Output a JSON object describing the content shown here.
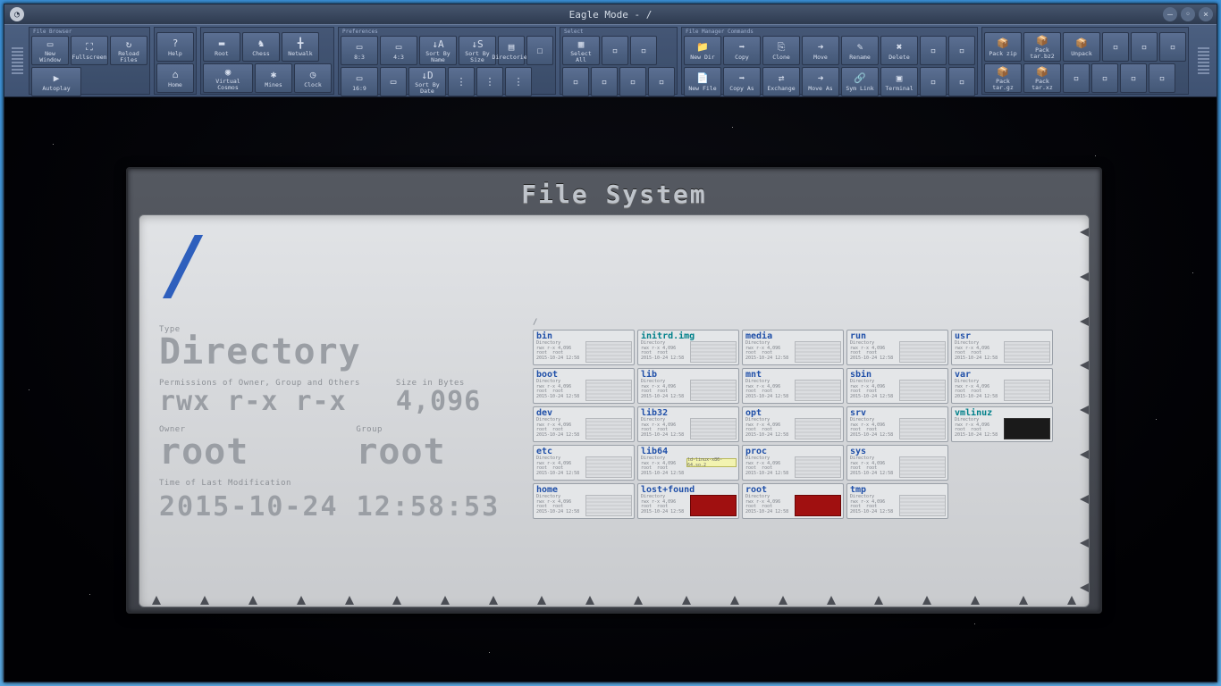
{
  "window": {
    "title": "Eagle Mode - /",
    "icon_glyph": "◔"
  },
  "toolbar": {
    "groups": [
      {
        "title": "File Browser",
        "rows": [
          [
            {
              "label": "New Window",
              "name": "new-window-button",
              "icon": "▭"
            },
            {
              "label": "Fullscreen",
              "name": "fullscreen-button",
              "icon": "⛶"
            },
            {
              "label": "Reload Files",
              "name": "reload-button",
              "icon": "↻"
            }
          ],
          [
            {
              "label": "Autoplay",
              "name": "autoplay-button",
              "icon": "▶",
              "wide": true
            }
          ]
        ]
      },
      {
        "title": "",
        "rows": [
          [
            {
              "label": "Help",
              "name": "help-button",
              "icon": "?"
            }
          ],
          [
            {
              "label": "Home",
              "name": "home-button",
              "icon": "⌂"
            }
          ]
        ]
      },
      {
        "title": "",
        "rows": [
          [
            {
              "label": "Root",
              "name": "root-button",
              "icon": "▬"
            },
            {
              "label": "Chess",
              "name": "chess-button",
              "icon": "♞"
            },
            {
              "label": "Netwalk",
              "name": "netwalk-button",
              "icon": "╋"
            }
          ],
          [
            {
              "label": "Virtual Cosmos",
              "name": "vcosmos-button",
              "icon": "◉",
              "wide": true
            },
            {
              "label": "Mines",
              "name": "mines-button",
              "icon": "✱"
            },
            {
              "label": "Clock",
              "name": "clock-button",
              "icon": "◷"
            }
          ]
        ]
      },
      {
        "title": "Preferences",
        "rows": [
          [
            {
              "label": "8:3",
              "name": "ratio-83-button",
              "icon": "▭"
            },
            {
              "label": "4:3",
              "name": "ratio-43-button",
              "icon": "▭"
            },
            {
              "label": "Sort By Name",
              "name": "sort-name-button",
              "icon": "↓A"
            },
            {
              "label": "Sort By Size",
              "name": "sort-size-button",
              "icon": "↓S"
            },
            {
              "label": "Directories",
              "name": "dirs-first-button",
              "icon": "▤",
              "narrow": true
            },
            {
              "label": "",
              "name": "pref-toggle-button",
              "icon": "☐",
              "narrow": true
            }
          ],
          [
            {
              "label": "16:9",
              "name": "ratio-169-button",
              "icon": "▭"
            },
            {
              "label": "",
              "name": "ratio-custom-button",
              "icon": "▭",
              "narrow": true
            },
            {
              "label": "Sort By Date",
              "name": "sort-date-button",
              "icon": "↓D"
            },
            {
              "label": "",
              "name": "pref-extra1-button",
              "icon": "⋮",
              "narrow": true
            },
            {
              "label": "",
              "name": "pref-extra2-button",
              "icon": "⋮",
              "narrow": true
            },
            {
              "label": "",
              "name": "pref-extra3-button",
              "icon": "⋮",
              "narrow": true
            }
          ]
        ]
      },
      {
        "title": "Select",
        "rows": [
          [
            {
              "label": "Select All",
              "name": "select-all-button",
              "icon": "▦"
            },
            {
              "label": "",
              "name": "select-ext1",
              "icon": "▫",
              "narrow": true
            },
            {
              "label": "",
              "name": "select-ext2",
              "icon": "▫",
              "narrow": true
            }
          ],
          [
            {
              "label": "",
              "name": "select-ext3",
              "icon": "▫",
              "narrow": true
            },
            {
              "label": "",
              "name": "select-ext4",
              "icon": "▫",
              "narrow": true
            },
            {
              "label": "",
              "name": "select-ext5",
              "icon": "▫",
              "narrow": true
            },
            {
              "label": "",
              "name": "select-ext6",
              "icon": "▫",
              "narrow": true
            }
          ]
        ]
      },
      {
        "title": "File Manager Commands",
        "rows": [
          [
            {
              "label": "New Dir",
              "name": "newdir-button",
              "icon": "📁"
            },
            {
              "label": "Copy",
              "name": "copy-button",
              "icon": "➡"
            },
            {
              "label": "Clone",
              "name": "clone-button",
              "icon": "⎘"
            },
            {
              "label": "Move",
              "name": "move-button",
              "icon": "➜"
            },
            {
              "label": "Rename",
              "name": "rename-button",
              "icon": "✎"
            },
            {
              "label": "Delete",
              "name": "delete-button",
              "icon": "✖"
            },
            {
              "label": "",
              "name": "fm-ext1",
              "icon": "▫",
              "narrow": true
            },
            {
              "label": "",
              "name": "fm-ext2",
              "icon": "▫",
              "narrow": true
            }
          ],
          [
            {
              "label": "New File",
              "name": "newfile-button",
              "icon": "📄"
            },
            {
              "label": "Copy As",
              "name": "copyas-button",
              "icon": "➡"
            },
            {
              "label": "Exchange",
              "name": "exchange-button",
              "icon": "⇄"
            },
            {
              "label": "Move As",
              "name": "moveas-button",
              "icon": "➜"
            },
            {
              "label": "Sym Link",
              "name": "symlink-button",
              "icon": "🔗"
            },
            {
              "label": "Terminal",
              "name": "terminal-button",
              "icon": "▣"
            },
            {
              "label": "",
              "name": "fm-ext3",
              "icon": "▫",
              "narrow": true
            },
            {
              "label": "",
              "name": "fm-ext4",
              "icon": "▫",
              "narrow": true
            }
          ]
        ]
      },
      {
        "title": "",
        "rows": [
          [
            {
              "label": "Pack zip",
              "name": "pack-zip-button",
              "icon": "📦"
            },
            {
              "label": "Pack tar.bz2",
              "name": "pack-tarbz2-button",
              "icon": "📦"
            },
            {
              "label": "Unpack",
              "name": "unpack-button",
              "icon": "📦"
            },
            {
              "label": "",
              "name": "pack-ext1",
              "icon": "▫",
              "narrow": true
            },
            {
              "label": "",
              "name": "pack-ext2",
              "icon": "▫",
              "narrow": true
            },
            {
              "label": "",
              "name": "pack-ext3",
              "icon": "▫",
              "narrow": true
            }
          ],
          [
            {
              "label": "Pack tar.gz",
              "name": "pack-targz-button",
              "icon": "📦"
            },
            {
              "label": "Pack tar.xz",
              "name": "pack-tarxz-button",
              "icon": "📦"
            },
            {
              "label": "",
              "name": "pack-ext4",
              "icon": "▫",
              "narrow": true
            },
            {
              "label": "",
              "name": "pack-ext5",
              "icon": "▫",
              "narrow": true
            },
            {
              "label": "",
              "name": "pack-ext6",
              "icon": "▫",
              "narrow": true
            },
            {
              "label": "",
              "name": "pack-ext7",
              "icon": "▫",
              "narrow": true
            }
          ]
        ]
      }
    ]
  },
  "panel": {
    "title": "File System",
    "path": "/",
    "grid_path": "/",
    "labels": {
      "type": "Type",
      "perms": "Permissions of Owner, Group and Others",
      "size": "Size in Bytes",
      "owner": "Owner",
      "group": "Group",
      "mtime": "Time of Last Modification"
    },
    "values": {
      "type": "Directory",
      "perms": "rwx r-x r-x",
      "size": "4,096",
      "owner": "root",
      "group": "root",
      "mtime": "2015-10-24 12:58:53"
    },
    "entries": [
      {
        "name": "bin",
        "kind": "dir"
      },
      {
        "name": "initrd.img",
        "kind": "link"
      },
      {
        "name": "media",
        "kind": "dir"
      },
      {
        "name": "run",
        "kind": "dir"
      },
      {
        "name": "usr",
        "kind": "dir"
      },
      {
        "name": "boot",
        "kind": "dir"
      },
      {
        "name": "lib",
        "kind": "dir"
      },
      {
        "name": "mnt",
        "kind": "dir"
      },
      {
        "name": "sbin",
        "kind": "dir"
      },
      {
        "name": "var",
        "kind": "dir"
      },
      {
        "name": "dev",
        "kind": "dir"
      },
      {
        "name": "lib32",
        "kind": "dir"
      },
      {
        "name": "opt",
        "kind": "dir"
      },
      {
        "name": "srv",
        "kind": "dir"
      },
      {
        "name": "vmlinuz",
        "kind": "link",
        "mini": "dark"
      },
      {
        "name": "etc",
        "kind": "dir"
      },
      {
        "name": "lib64",
        "kind": "dir",
        "mini": "tag",
        "tagtext": "ld-linux-x86-64.so.2"
      },
      {
        "name": "proc",
        "kind": "dir"
      },
      {
        "name": "sys",
        "kind": "dir"
      },
      {
        "name": "",
        "kind": "empty"
      },
      {
        "name": "home",
        "kind": "dir"
      },
      {
        "name": "lost+found",
        "kind": "dir",
        "mini": "red"
      },
      {
        "name": "root",
        "kind": "dir",
        "mini": "red"
      },
      {
        "name": "tmp",
        "kind": "dir"
      },
      {
        "name": "",
        "kind": "empty"
      }
    ],
    "entry_meta": "Directory\nrwx r-x 4,096\nroot  root\n2015-10-24 12:58"
  }
}
